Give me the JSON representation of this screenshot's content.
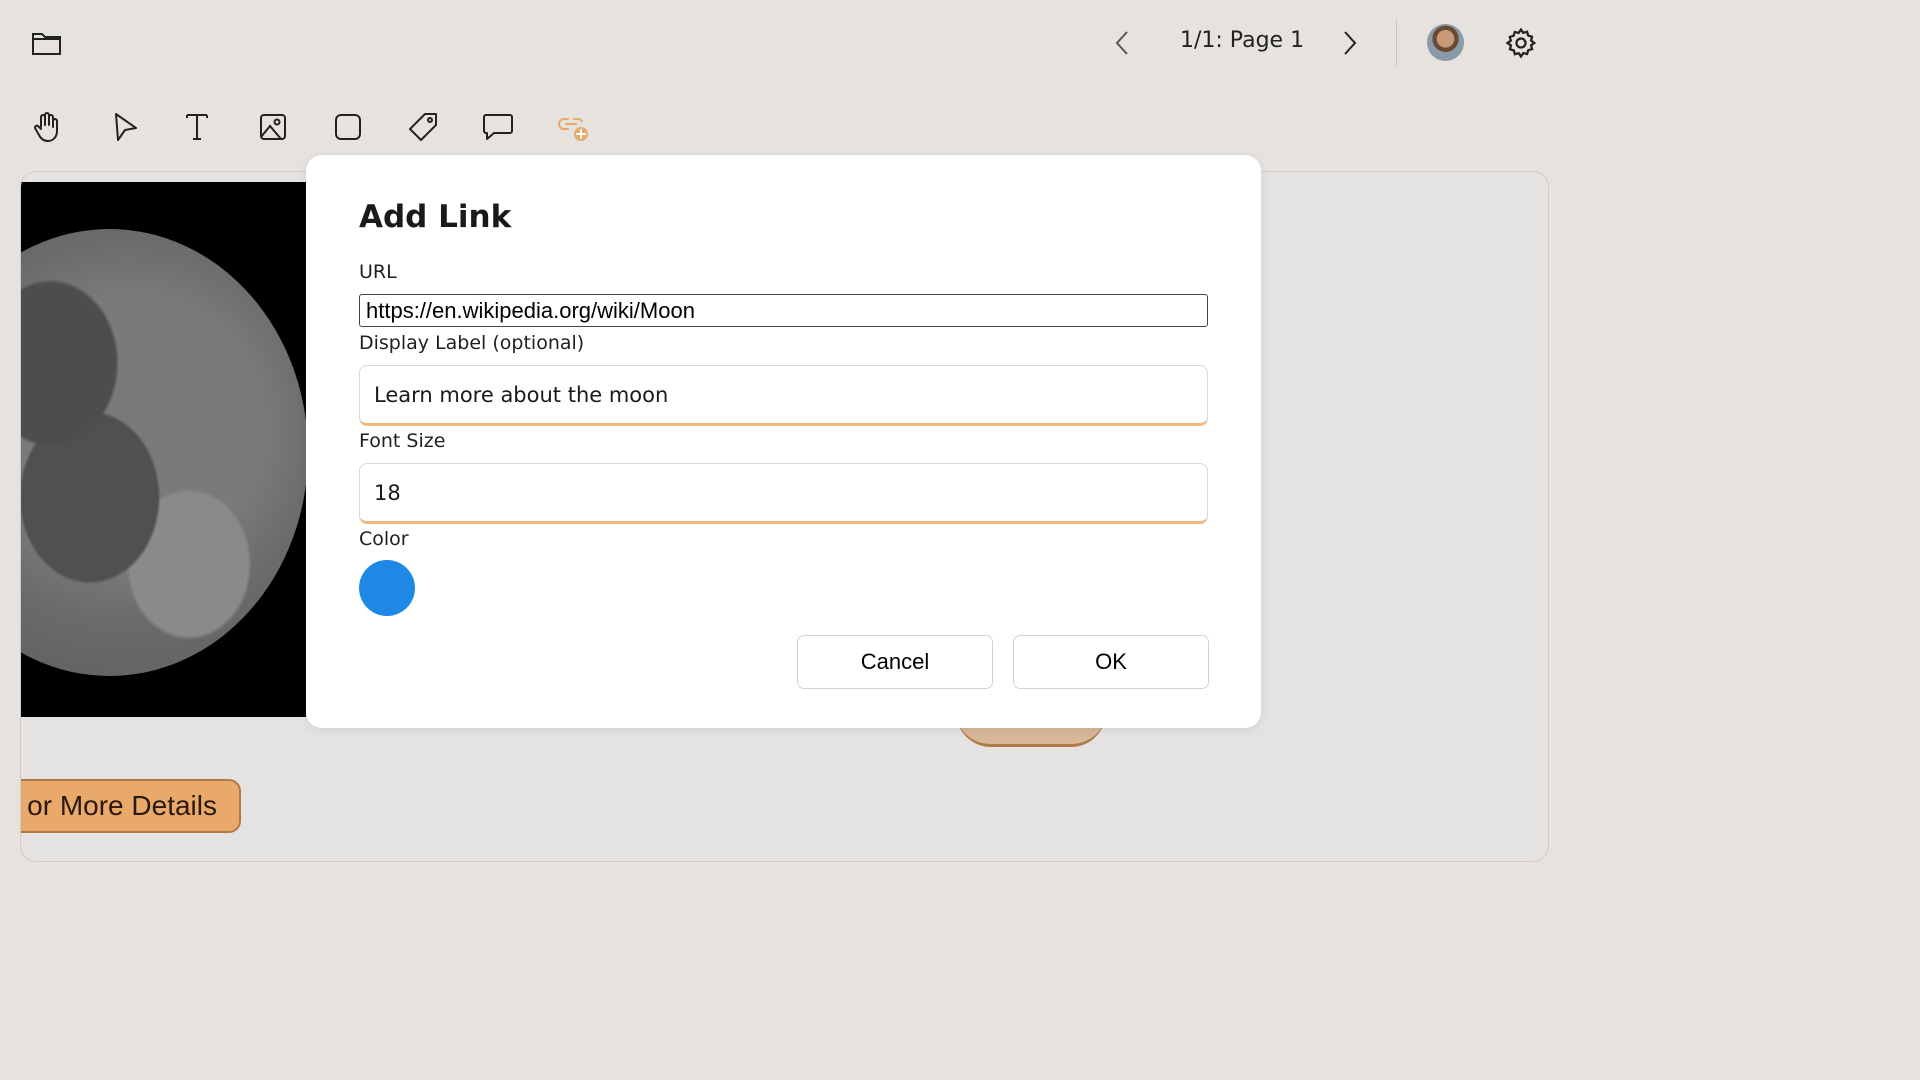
{
  "topbar": {
    "folder_icon": "folder-icon",
    "page_label": "1/1: Page 1",
    "prev_icon": "chevron-left-icon",
    "next_icon": "chevron-right-icon",
    "settings_icon": "gear-icon"
  },
  "toolbar": {
    "tools": [
      "hand-icon",
      "pointer-icon",
      "text-icon",
      "image-icon",
      "rectangle-icon",
      "tag-icon",
      "comment-icon",
      "add-link-icon"
    ],
    "active_color": "#e8a96a"
  },
  "canvas": {
    "details_button_label": "or More Details"
  },
  "dialog": {
    "title": "Add Link",
    "url_label": "URL",
    "url_value": "https://en.wikipedia.org/wiki/Moon",
    "display_label_label": "Display Label (optional)",
    "display_label_value": "Learn more about the moon",
    "font_size_label": "Font Size",
    "font_size_value": "18",
    "color_label": "Color",
    "color_value": "#1f88e5",
    "cancel_label": "Cancel",
    "ok_label": "OK"
  }
}
